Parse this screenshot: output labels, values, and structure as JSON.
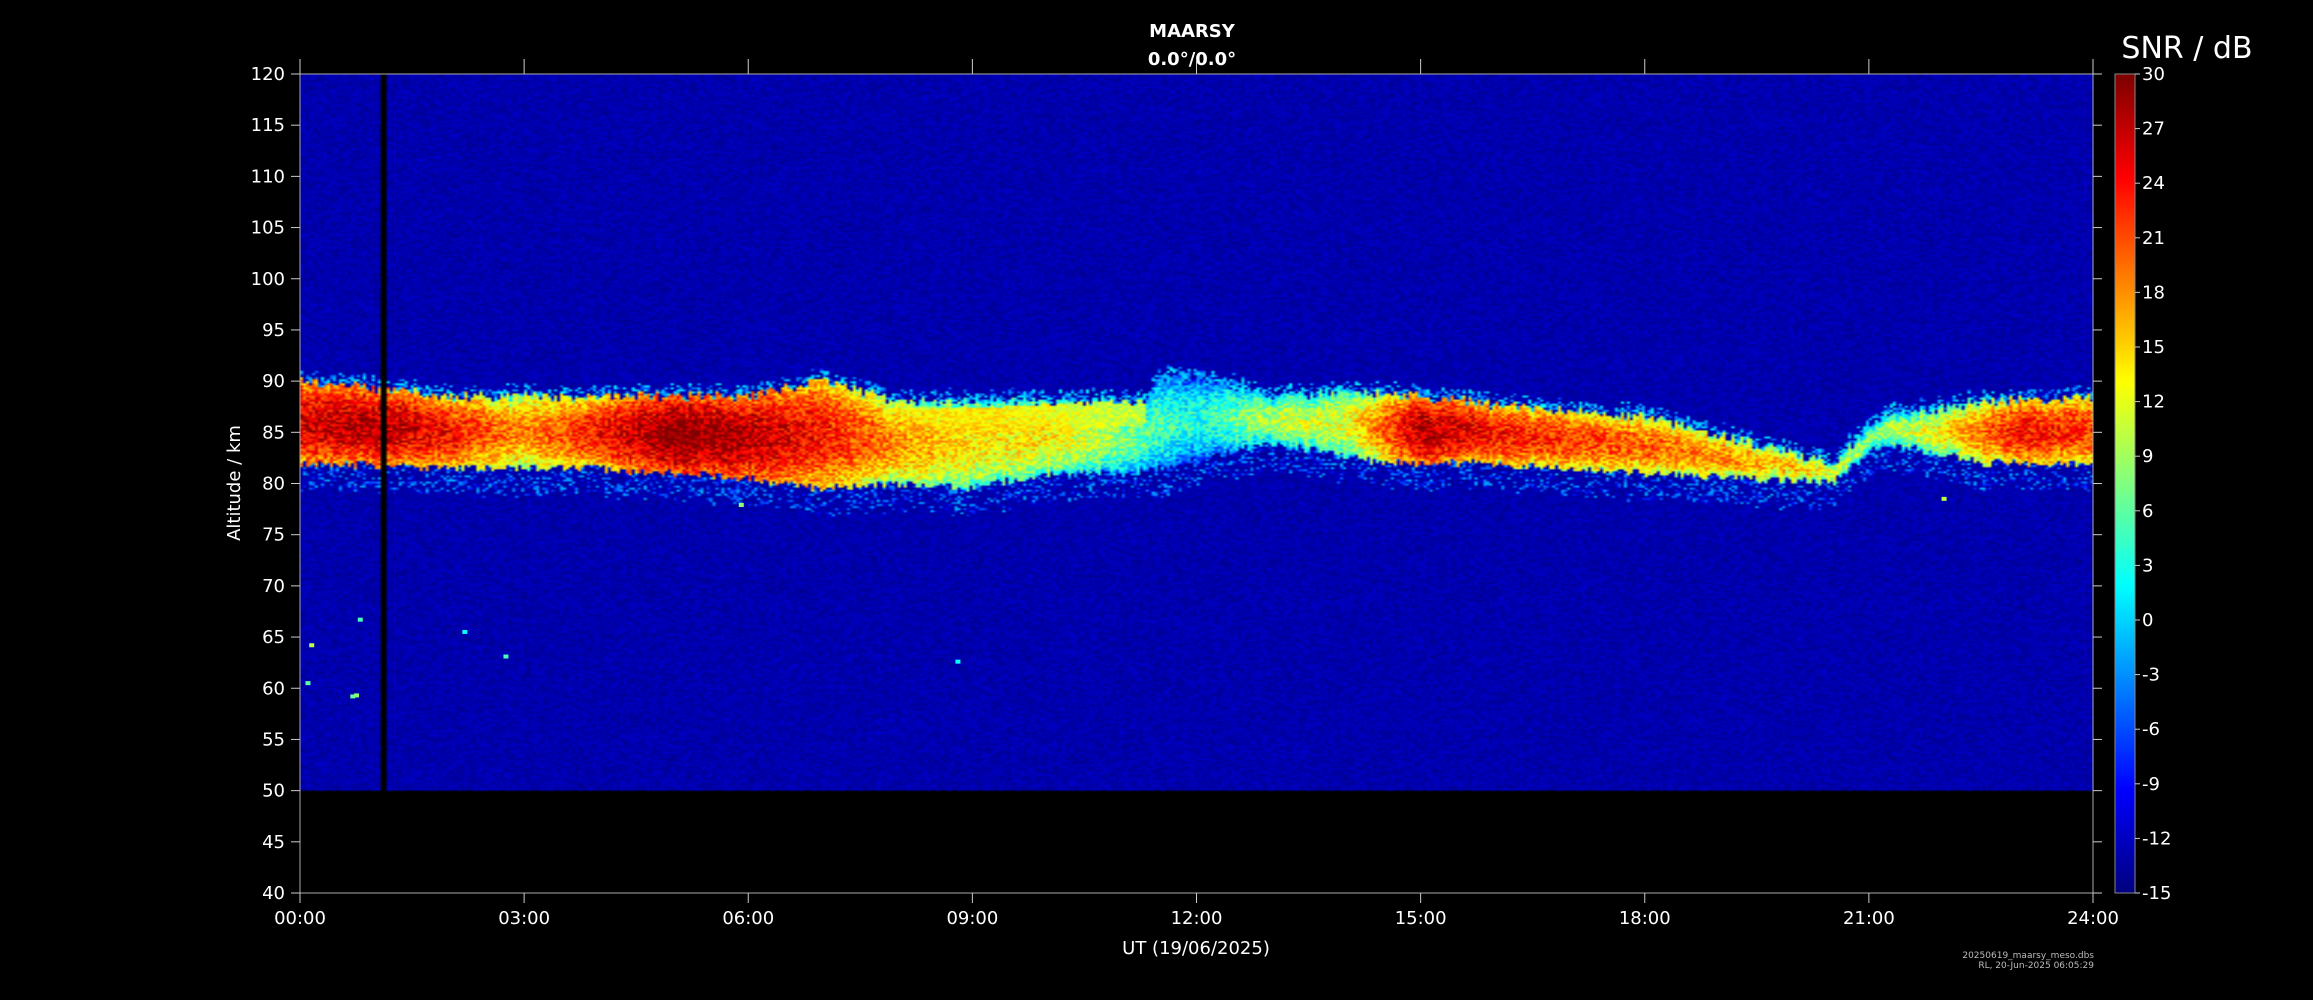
{
  "chart_data": {
    "type": "heatmap",
    "title": "MAARSY",
    "subtitle": "0.0°/0.0°",
    "xlabel": "UT (19/06/2025)",
    "ylabel": "Altitude / km",
    "xlim": [
      0,
      24
    ],
    "ylim": [
      40,
      120
    ],
    "x_ticks": [
      "00:00",
      "03:00",
      "06:00",
      "09:00",
      "12:00",
      "15:00",
      "18:00",
      "21:00",
      "24:00"
    ],
    "y_ticks": [
      40,
      45,
      50,
      55,
      60,
      65,
      70,
      75,
      80,
      85,
      90,
      95,
      100,
      105,
      110,
      115,
      120
    ],
    "data_altitude_range_km": [
      50,
      120
    ],
    "data_gap_ut_hours": [
      1.08,
      1.16
    ],
    "background_snr_db": -13,
    "colorbar": {
      "label": "SNR / dB",
      "range": [
        -15,
        30
      ],
      "ticks": [
        30,
        27,
        24,
        21,
        18,
        15,
        12,
        9,
        6,
        3,
        0,
        -3,
        -6,
        -9,
        -12,
        -15
      ],
      "colormap": "jet"
    },
    "echo_layer": {
      "description_units": "UT hours, km, dB",
      "lower_edge_km": [
        [
          0,
          82
        ],
        [
          2,
          81.5
        ],
        [
          4,
          81.5
        ],
        [
          6,
          80.5
        ],
        [
          7,
          79.5
        ],
        [
          8,
          80
        ],
        [
          9,
          79.5
        ],
        [
          10,
          81
        ],
        [
          11.3,
          81
        ],
        [
          13,
          84
        ],
        [
          14.5,
          82
        ],
        [
          16,
          82
        ],
        [
          18,
          81
        ],
        [
          20.5,
          80
        ],
        [
          21.2,
          84
        ],
        [
          22.5,
          82
        ],
        [
          24,
          82
        ]
      ],
      "upper_edge_km": [
        [
          0,
          90
        ],
        [
          2,
          88.5
        ],
        [
          4,
          88.5
        ],
        [
          6,
          88.5
        ],
        [
          7,
          90
        ],
        [
          8,
          88
        ],
        [
          9,
          88
        ],
        [
          11.3,
          88
        ],
        [
          11.5,
          90.5
        ],
        [
          12.5,
          89.5
        ],
        [
          13,
          88.5
        ],
        [
          14,
          89
        ],
        [
          15,
          88.5
        ],
        [
          17,
          87
        ],
        [
          18,
          86.5
        ],
        [
          20.5,
          82
        ],
        [
          21.2,
          86.5
        ],
        [
          22.5,
          88
        ],
        [
          24,
          88.5
        ]
      ],
      "peak_snr_db": [
        [
          0,
          26
        ],
        [
          1,
          28
        ],
        [
          2,
          24
        ],
        [
          3,
          18
        ],
        [
          5,
          30
        ],
        [
          6,
          28
        ],
        [
          7,
          24
        ],
        [
          8,
          18
        ],
        [
          9,
          14
        ],
        [
          10,
          14
        ],
        [
          11.3,
          6
        ],
        [
          12,
          3
        ],
        [
          13,
          10
        ],
        [
          14,
          12
        ],
        [
          15,
          28
        ],
        [
          16,
          24
        ],
        [
          18,
          20
        ],
        [
          20,
          16
        ],
        [
          21,
          8
        ],
        [
          22,
          14
        ],
        [
          23,
          24
        ],
        [
          24,
          22
        ]
      ],
      "high_layer_km": [
        [
          0,
          87
        ],
        [
          2,
          86
        ],
        [
          4,
          86
        ],
        [
          6,
          86
        ],
        [
          7,
          87
        ],
        [
          8,
          86
        ],
        [
          9,
          86
        ],
        [
          11.3,
          87
        ]
      ],
      "high_layer_snr_db": [
        [
          0,
          14
        ],
        [
          2,
          10
        ],
        [
          4,
          10
        ],
        [
          6,
          14
        ],
        [
          7,
          12
        ],
        [
          8,
          12
        ],
        [
          9,
          14
        ],
        [
          11.3,
          10
        ]
      ]
    },
    "isolated_points": [
      [
        0.1,
        60.5,
        6
      ],
      [
        0.15,
        64.2,
        10
      ],
      [
        0.7,
        59.2,
        6
      ],
      [
        0.75,
        59.3,
        8
      ],
      [
        0.8,
        66.7,
        5
      ],
      [
        2.2,
        65.5,
        2
      ],
      [
        2.75,
        63.1,
        5
      ],
      [
        5.9,
        77.9,
        8
      ],
      [
        8.8,
        62.6,
        2
      ],
      [
        22.0,
        78.5,
        10
      ]
    ],
    "footnote_file": "20250619_maarsy_meso.dbs",
    "footnote_stamp": "RL, 20-Jun-2025 06:05:29"
  }
}
